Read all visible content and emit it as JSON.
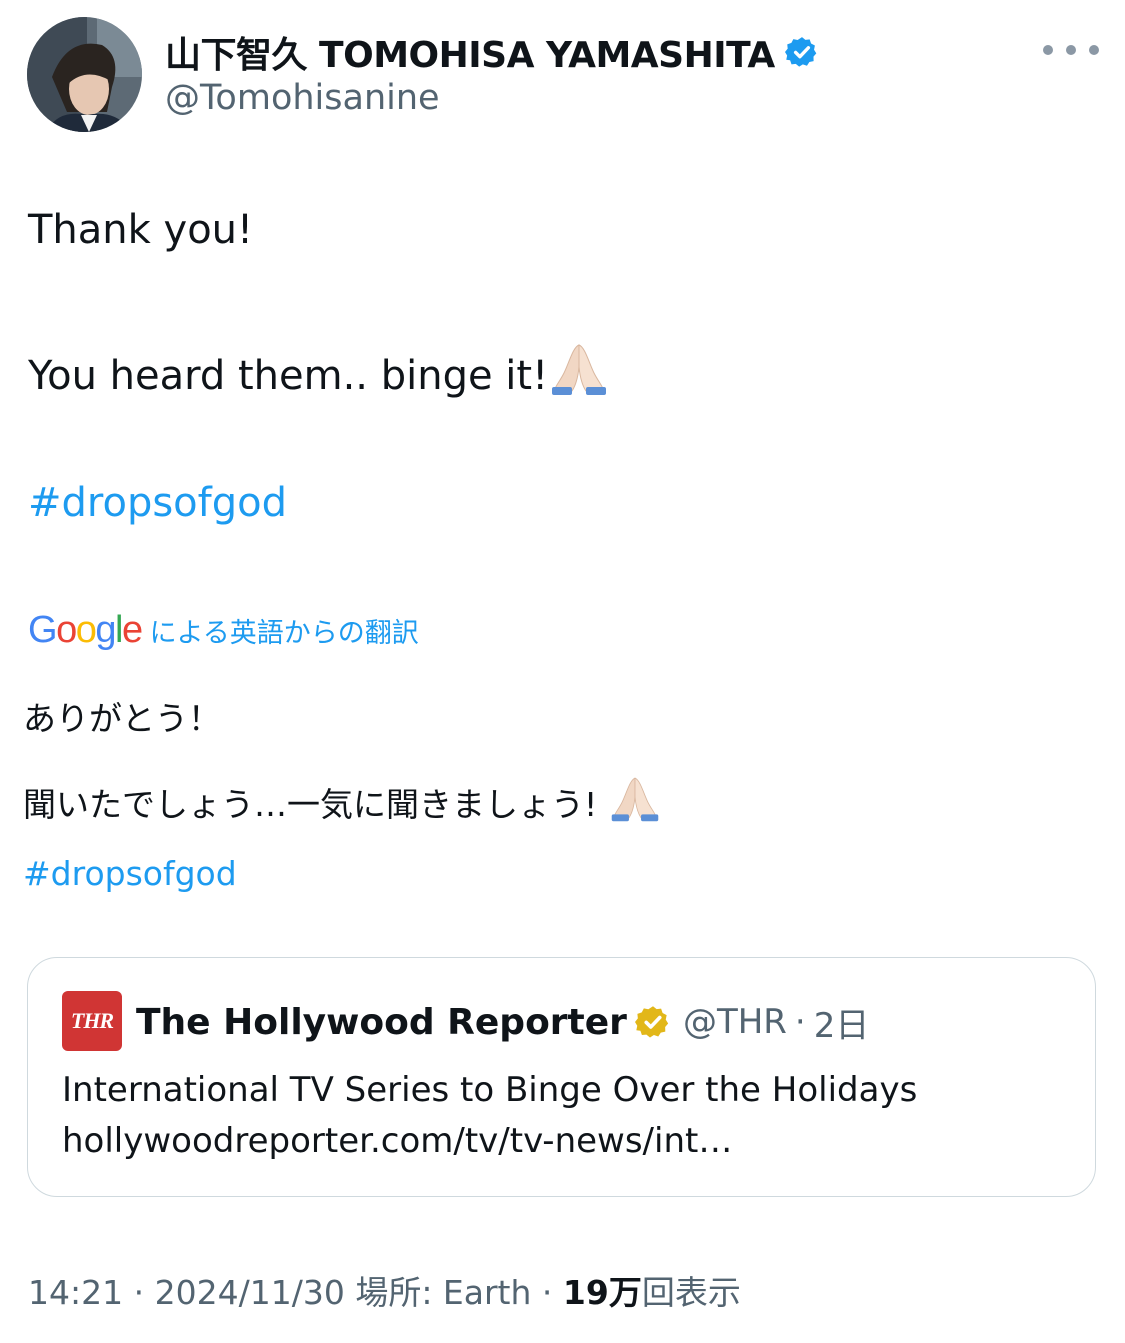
{
  "author": {
    "display_name": "山下智久 TOMOHISA YAMASHITA",
    "handle": "@Tomohisanine",
    "avatar": "profile-photo",
    "verified_color": "#1d9bf0"
  },
  "tweet": {
    "line1": "Thank you!",
    "line2": "You heard them.. binge it!",
    "hashtag": "#dropsofgod",
    "emoji": "folded-hands"
  },
  "translation": {
    "logo_text": "Google",
    "label": "による英語からの翻訳",
    "line1": "ありがとう！",
    "line2": "聞いたでしょう…一気に聞きましょう!",
    "hashtag": "#dropsofgod"
  },
  "quoted": {
    "logo_text": "THR",
    "name": "The Hollywood Reporter",
    "handle": "@THR",
    "separator": "·",
    "time": "2日",
    "text": "International TV Series to Binge Over the Holidays",
    "url": "hollywoodreporter.com/tv/tv-news/int…",
    "logo_color": "#d03534",
    "badge_color": "#e2b719"
  },
  "footer": {
    "time": "14:21",
    "sep1": "·",
    "date": "2024/11/30",
    "location_label": "場所: Earth",
    "sep2": "·",
    "views_count": "19万",
    "views_label": "回表示"
  },
  "colors": {
    "link": "#1d9bf0",
    "secondary": "#536471",
    "text": "#0f1419"
  }
}
